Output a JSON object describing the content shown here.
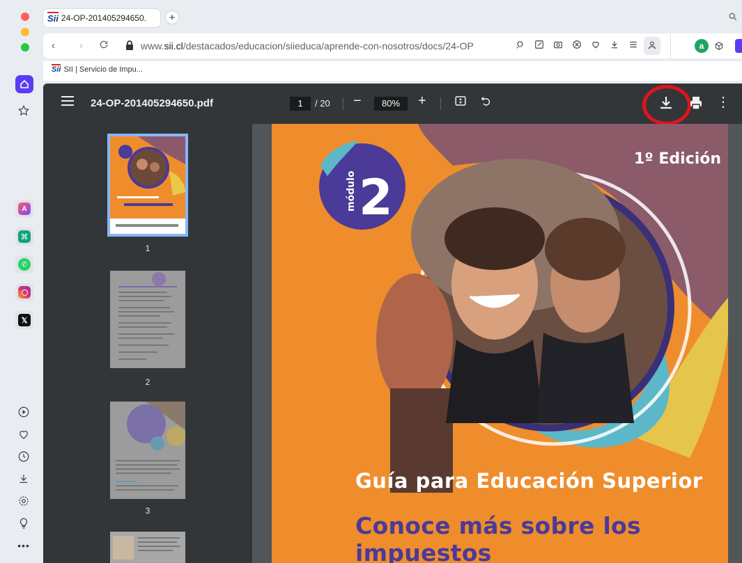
{
  "tab": {
    "title": "24-OP-201405294650.",
    "favicon_text": "Sii"
  },
  "address_bar": {
    "url_prefix": "www.",
    "url_domain": "sii.cl",
    "url_path": "/destacados/educacion/siieduca/aprende-con-nosotros/docs/24-OP"
  },
  "bookmarks": [
    {
      "label": "SII | Servicio de Impu...",
      "icon_text": "Sii"
    }
  ],
  "pdf_toolbar": {
    "title": "24-OP-201405294650.pdf",
    "current_page": "1",
    "total_pages": "/ 20",
    "zoom": "80%"
  },
  "thumbnails": [
    {
      "page": "1",
      "selected": true
    },
    {
      "page": "2",
      "selected": false
    },
    {
      "page": "3",
      "selected": false
    }
  ],
  "page_content": {
    "module_label": "módulo",
    "module_number": "2",
    "edition": "1º Edición",
    "subtitle": "Guía para Educación Superior",
    "headline": "Conoce más sobre los impuestos"
  },
  "colors": {
    "highlight": "#e0141c",
    "page_orange": "#ef8d2d",
    "module_purple": "#4b3a97"
  },
  "icons": {
    "sidebar": [
      "workspace-icon",
      "star-icon",
      "app-icon",
      "chatgpt-icon",
      "whatsapp-icon",
      "instagram-icon",
      "x-icon",
      "play-icon",
      "heart-icon",
      "history-icon",
      "download-icon",
      "settings-icon",
      "lightbulb-icon",
      "more-icon"
    ]
  }
}
